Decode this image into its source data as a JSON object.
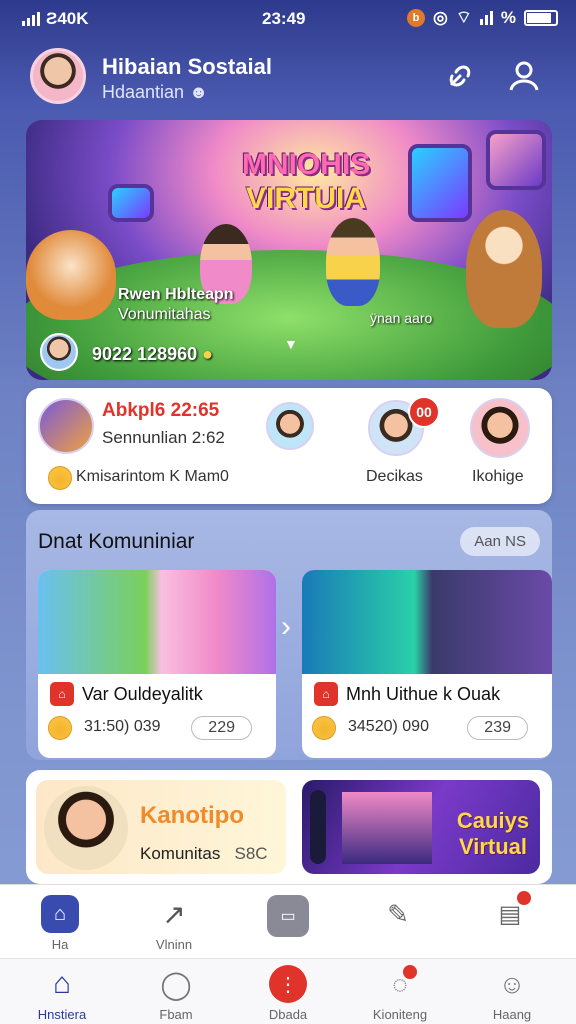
{
  "status": {
    "carrier": "Ƨ40K",
    "time": "23:49",
    "battery_text": "%"
  },
  "header": {
    "title": "Hibaian Sostaial",
    "subtitle": "Hdaantian"
  },
  "hero": {
    "title_line1": "MNIOHIS",
    "title_line2": "VIRTUIA",
    "caption1": "Rwen Hblteapn",
    "caption2": "Vonumitahas",
    "tag": "ÿnan aaro",
    "count": "9022 128960"
  },
  "profile": {
    "name": "Abkpl6",
    "time": "22:65",
    "subtitle": "Sennunlian 2:62",
    "status": "Kmisarintom K Mam0",
    "badge": "00",
    "friend1": "Decikas",
    "friend2": "Ikohige"
  },
  "community": {
    "title": "Dnat Komuniniar",
    "see_all": "Aan NS",
    "cards": [
      {
        "title": "Var Ouldeyalitk",
        "count": "31:50) 039",
        "pill": "229"
      },
      {
        "title": "Mnh Uithue k Ouak",
        "count": "34520) 090",
        "pill": "239"
      }
    ]
  },
  "promos": [
    {
      "title": "Kanotipo",
      "subtitle": "Komunitas",
      "extra": "S8C"
    },
    {
      "title_line1": "Cauiys",
      "title_line2": "Virtual"
    }
  ],
  "tabbar_top": [
    "Ha",
    "Vlninn",
    "",
    "",
    ""
  ],
  "tabbar_bottom": [
    "Hnstiera",
    "Fbam",
    "Dbada",
    "Kioniteng",
    "Haang"
  ],
  "colors": {
    "accent": "#3a4bb0",
    "red": "#e0332a",
    "orange": "#f08a2a"
  }
}
